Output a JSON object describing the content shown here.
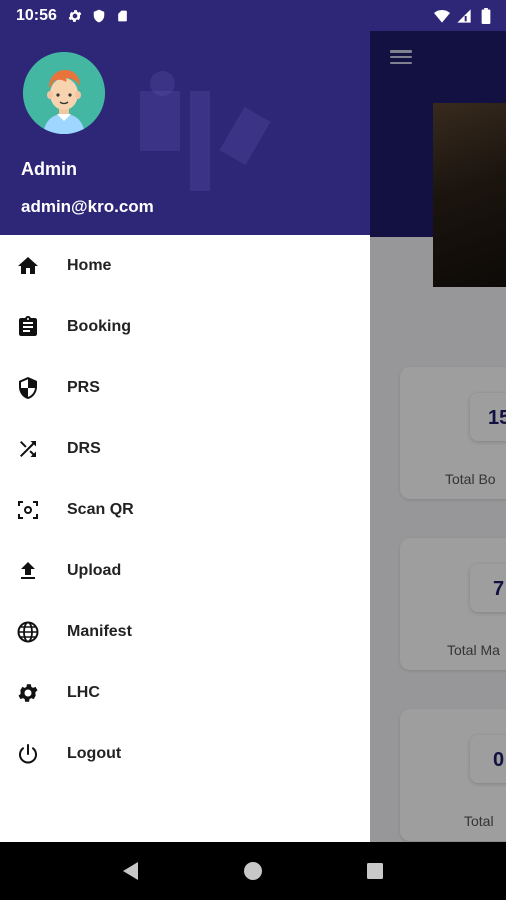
{
  "status_bar": {
    "time": "10:56",
    "left_icons": [
      "gear-icon",
      "shield-icon",
      "sim-card-icon"
    ],
    "right_icons": [
      "wifi-icon",
      "signal-icon",
      "battery-icon"
    ]
  },
  "drawer": {
    "user": {
      "name": "Admin",
      "email": "admin@kro.com"
    },
    "items": [
      {
        "label": "Home",
        "icon": "home-icon"
      },
      {
        "label": "Booking",
        "icon": "clipboard-icon"
      },
      {
        "label": "PRS",
        "icon": "shield-icon"
      },
      {
        "label": "DRS",
        "icon": "shuffle-icon"
      },
      {
        "label": "Scan QR",
        "icon": "scan-icon"
      },
      {
        "label": "Upload",
        "icon": "upload-icon"
      },
      {
        "label": "Manifest",
        "icon": "globe-icon"
      },
      {
        "label": "LHC",
        "icon": "gear-icon"
      },
      {
        "label": "Logout",
        "icon": "power-icon"
      }
    ]
  },
  "background": {
    "stats": [
      {
        "value": "15",
        "label": "Total Bo"
      },
      {
        "value": "7",
        "label": "Total Ma"
      },
      {
        "value": "0",
        "label": "Total"
      }
    ]
  },
  "colors": {
    "header": "#2e2677",
    "app_header": "#1f1a6b",
    "scrim": "rgba(0,0,0,0.38)"
  }
}
